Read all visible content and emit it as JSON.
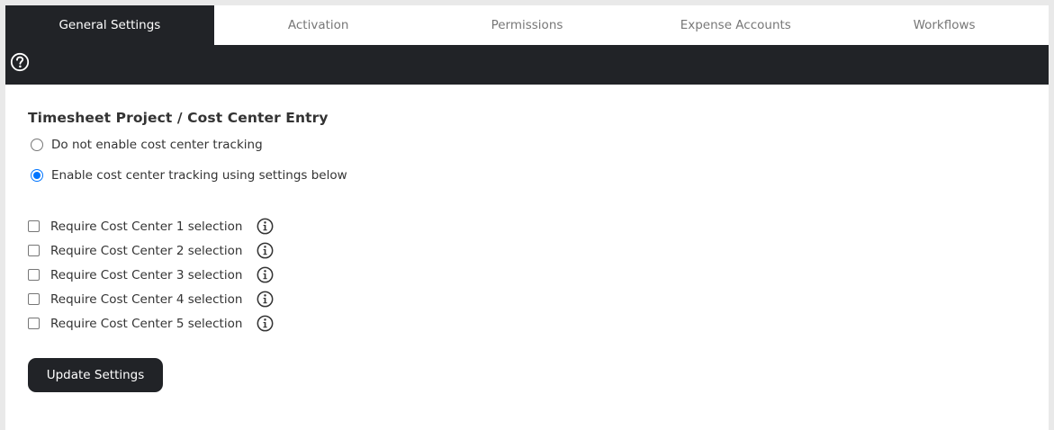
{
  "tabs": [
    {
      "label": "General Settings",
      "active": true
    },
    {
      "label": "Activation",
      "active": false
    },
    {
      "label": "Permissions",
      "active": false
    },
    {
      "label": "Expense Accounts",
      "active": false
    },
    {
      "label": "Workflows",
      "active": false
    }
  ],
  "toolbar": {
    "help_icon": "question-circle-icon"
  },
  "section": {
    "title": "Timesheet Project / Cost Center Entry",
    "radios": [
      {
        "label": "Do not enable cost center tracking",
        "checked": false
      },
      {
        "label": "Enable cost center tracking using settings below",
        "checked": true
      }
    ],
    "checkboxes": [
      {
        "label": "Require Cost Center 1 selection",
        "checked": false,
        "icon": "info-icon"
      },
      {
        "label": "Require Cost Center 2 selection",
        "checked": false,
        "icon": "info-icon"
      },
      {
        "label": "Require Cost Center 3 selection",
        "checked": false,
        "icon": "info-icon"
      },
      {
        "label": "Require Cost Center 4 selection",
        "checked": false,
        "icon": "info-icon"
      },
      {
        "label": "Require Cost Center 5 selection",
        "checked": false,
        "icon": "info-icon"
      }
    ]
  },
  "actions": {
    "update_label": "Update Settings"
  },
  "colors": {
    "dark": "#212327",
    "accent": "#0075ff",
    "tab_inactive_text": "#777777"
  }
}
